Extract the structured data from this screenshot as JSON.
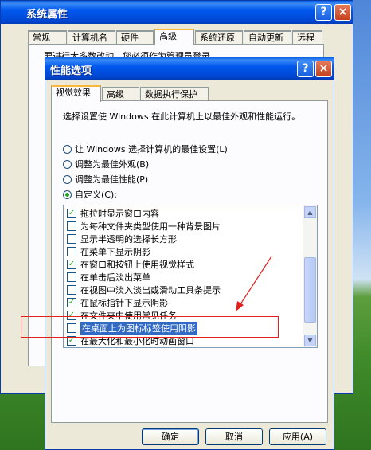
{
  "outer_window": {
    "title": "系统属性",
    "help_label": "?",
    "close_label": "×",
    "tabs": [
      "常规",
      "计算机名",
      "硬件",
      "高级",
      "系统还原",
      "自动更新",
      "远程"
    ],
    "note": "要进行大多数改动，您必须作为管理员登录。"
  },
  "inner_window": {
    "title": "性能选项",
    "help_label": "?",
    "close_label": "×",
    "tabs": [
      "视觉效果",
      "高级",
      "数据执行保护"
    ],
    "description": "选择设置使 Windows 在此计算机上以最佳外观和性能运行。",
    "radios": [
      {
        "label": "让 Windows 选择计算机的最佳设置(L)",
        "checked": false
      },
      {
        "label": "调整为最佳外观(B)",
        "checked": false
      },
      {
        "label": "调整为最佳性能(P)",
        "checked": false
      },
      {
        "label": "自定义(C):",
        "checked": true
      }
    ],
    "effects": [
      {
        "label": "拖拉时显示窗口内容",
        "checked": true
      },
      {
        "label": "为每种文件夹类型使用一种背景图片",
        "checked": false
      },
      {
        "label": "显示半透明的选择长方形",
        "checked": false
      },
      {
        "label": "在菜单下显示阴影",
        "checked": false
      },
      {
        "label": "在窗口和按钮上使用视觉样式",
        "checked": true
      },
      {
        "label": "在单击后淡出菜单",
        "checked": false
      },
      {
        "label": "在视图中淡入淡出或滑动工具条提示",
        "checked": false
      },
      {
        "label": "在鼠标指针下显示阴影",
        "checked": true
      },
      {
        "label": "在文件夹中使用常见任务",
        "checked": true
      },
      {
        "label": "在桌面上为图标标签使用阴影",
        "checked": false,
        "selected": true
      },
      {
        "label": "在最大化和最小化时动画窗口",
        "checked": true
      }
    ],
    "buttons": {
      "ok": "确定",
      "cancel": "取消",
      "apply": "应用(A)"
    }
  },
  "colors": {
    "annotation": "#e3201b",
    "titlebar": "#0058ee",
    "selection": "#316ac5"
  }
}
